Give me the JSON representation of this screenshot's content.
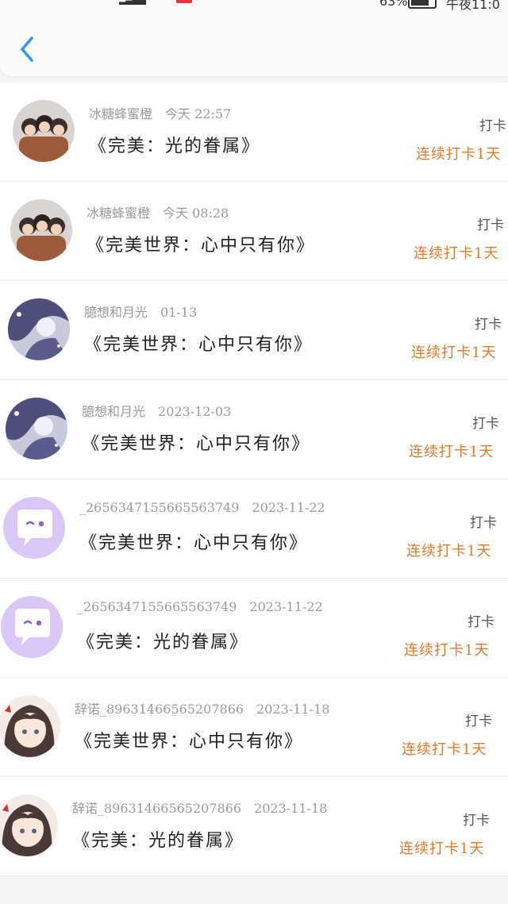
{
  "status_bar": {
    "battery": "63%",
    "time": "午夜11:0"
  },
  "header": {
    "back_icon": "chevron-left-icon"
  },
  "colors": {
    "accent_blue": "#2b9af3",
    "streak_orange": "#e07b2c",
    "meta_gray": "#9a9a9a"
  },
  "records": [
    {
      "user": "冰糖蜂蜜橙",
      "date": "今天 22:57",
      "book": "《完美：光的眷属》",
      "action": "打卡",
      "streak": "连续打卡1天",
      "avatar": "photo-group-avatar"
    },
    {
      "user": "冰糖蜂蜜橙",
      "date": "今天 08:28",
      "book": "《完美世界：心中只有你》",
      "action": "打卡",
      "streak": "连续打卡1天",
      "avatar": "photo-group-avatar"
    },
    {
      "user": "臆想和月光",
      "date": "01-13",
      "book": "《完美世界：心中只有你》",
      "action": "打卡",
      "streak": "连续打卡1天",
      "avatar": "anime-blue-avatar"
    },
    {
      "user": "臆想和月光",
      "date": "2023-12-03",
      "book": "《完美世界：心中只有你》",
      "action": "打卡",
      "streak": "连续打卡1天",
      "avatar": "anime-blue-avatar"
    },
    {
      "user": "_265634715566556374​9",
      "date": "2023-11-22",
      "book": "《完美世界：心中只有你》",
      "action": "打卡",
      "streak": "连续打卡1天",
      "avatar": "default-chat-avatar"
    },
    {
      "user": "_2656347155665563749",
      "date": "2023-11-22",
      "book": "《完美：光的眷属》",
      "action": "打卡",
      "streak": "连续打卡1天",
      "avatar": "default-chat-avatar"
    },
    {
      "user": "辞诺_8963146656520​7866",
      "date": "2023-11-18",
      "book": "《完美世界：心中只有你》",
      "action": "打卡",
      "streak": "连续打卡1天",
      "avatar": "anime-girl-avatar"
    },
    {
      "user": "辞诺_89631466565207866",
      "date": "2023-11-18",
      "book": "《完美：光的眷属》",
      "action": "打卡",
      "streak": "连续打卡1天",
      "avatar": "anime-girl-avatar"
    }
  ]
}
